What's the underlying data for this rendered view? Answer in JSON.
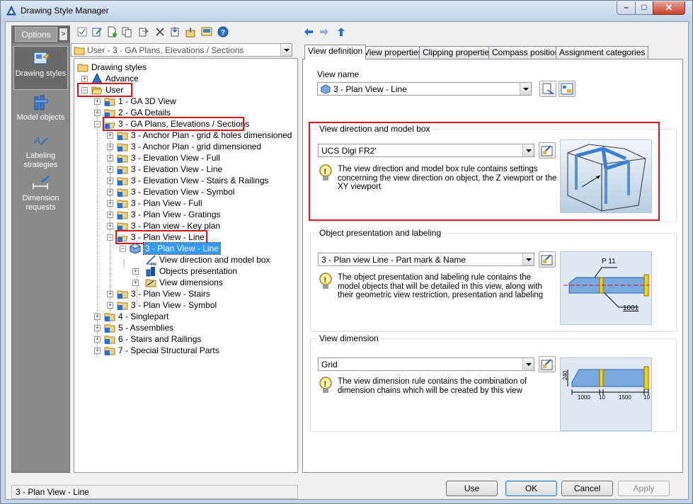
{
  "window": {
    "title": "Drawing Style Manager"
  },
  "options_panel": {
    "header": "Options",
    "items": [
      {
        "label": "Drawing styles",
        "icon": "drawing-styles-icon",
        "selected": true
      },
      {
        "label": "Model objects",
        "icon": "model-objects-icon"
      },
      {
        "label": "Labeling strategies",
        "icon": "labeling-strategies-icon"
      },
      {
        "label": "Dimension requests",
        "icon": "dimension-requests-icon"
      }
    ]
  },
  "left_toolbar": {
    "icons": [
      "check-icon",
      "edit-icon",
      "new-icon",
      "copy-icon",
      "paste-icon",
      "delete-icon",
      "import-icon",
      "export-icon",
      "preview-icon",
      "help-icon"
    ]
  },
  "path_combo": {
    "value": "User - 3 - GA Plans, Elevations / Sections"
  },
  "tree": {
    "root": "Drawing styles",
    "advance": "Advance",
    "user": "User",
    "ga3d": "1 - GA 3D View",
    "gadetails": "2 - GA Details",
    "gaplans": "3 - GA Plans, Elevations / Sections",
    "children": [
      "3 - Anchor Plan - grid & holes dimensioned",
      "3 - Anchor Plan - grid dimensioned",
      "3 - Elevation View - Full",
      "3 - Elevation View - Line",
      "3 - Elevation View - Stairs & Railings",
      "3 - Elevation View - Symbol",
      "3 - Plan View - Full",
      "3 - Plan View - Gratings",
      "3 - Plan view - Key plan",
      "3 - Plan View - Line",
      "3 - Plan View - Stairs",
      "3 - Plan View - Symbol"
    ],
    "selected_view": "3 - Plan View - Line",
    "view_parts": [
      "View direction and model box",
      "Objects presentation",
      "View dimensions"
    ],
    "others": [
      "4 - Singlepart",
      "5 - Assemblies",
      "6 - Stairs and Railings",
      "7 - Special Structural Parts"
    ]
  },
  "tabs": [
    "View definition",
    "View properties",
    "Clipping properties",
    "Compass position",
    "Assignment categories"
  ],
  "view_name": {
    "label": "View name",
    "value": "3 - Plan View - Line"
  },
  "view_direction": {
    "title": "View direction and model box",
    "value": "UCS Digi FR2'",
    "description": "The view direction and model box rule contains settings concerning the view direction on object, the Z viewport or the XY viewport"
  },
  "object_presentation": {
    "title": "Object presentation and labeling",
    "value": "3 - Plan view Line - Part mark & Name",
    "description": "The object presentation and labeling rule contains the model objects that will be detailed in this view, along with their geometric view restriction, presentation and labeling",
    "preview_labels": {
      "top": "P 11",
      "bottom": "1001"
    }
  },
  "view_dimension": {
    "title": "View dimension",
    "value": "Grid",
    "description": "The view dimension rule contains the combination of dimension chains which will be created by this view",
    "preview_labels": {
      "height": "240",
      "d1": "1000",
      "d2": "10",
      "d3": "1500",
      "d4": "10"
    }
  },
  "status": {
    "text": "3 - Plan View - Line"
  },
  "buttons": {
    "use": "Use",
    "ok": "OK",
    "cancel": "Cancel",
    "apply": "Apply"
  },
  "colors": {
    "highlight_box": "#e0141e",
    "selection": "#3399ff",
    "titlebar": "#c4d5ea"
  }
}
